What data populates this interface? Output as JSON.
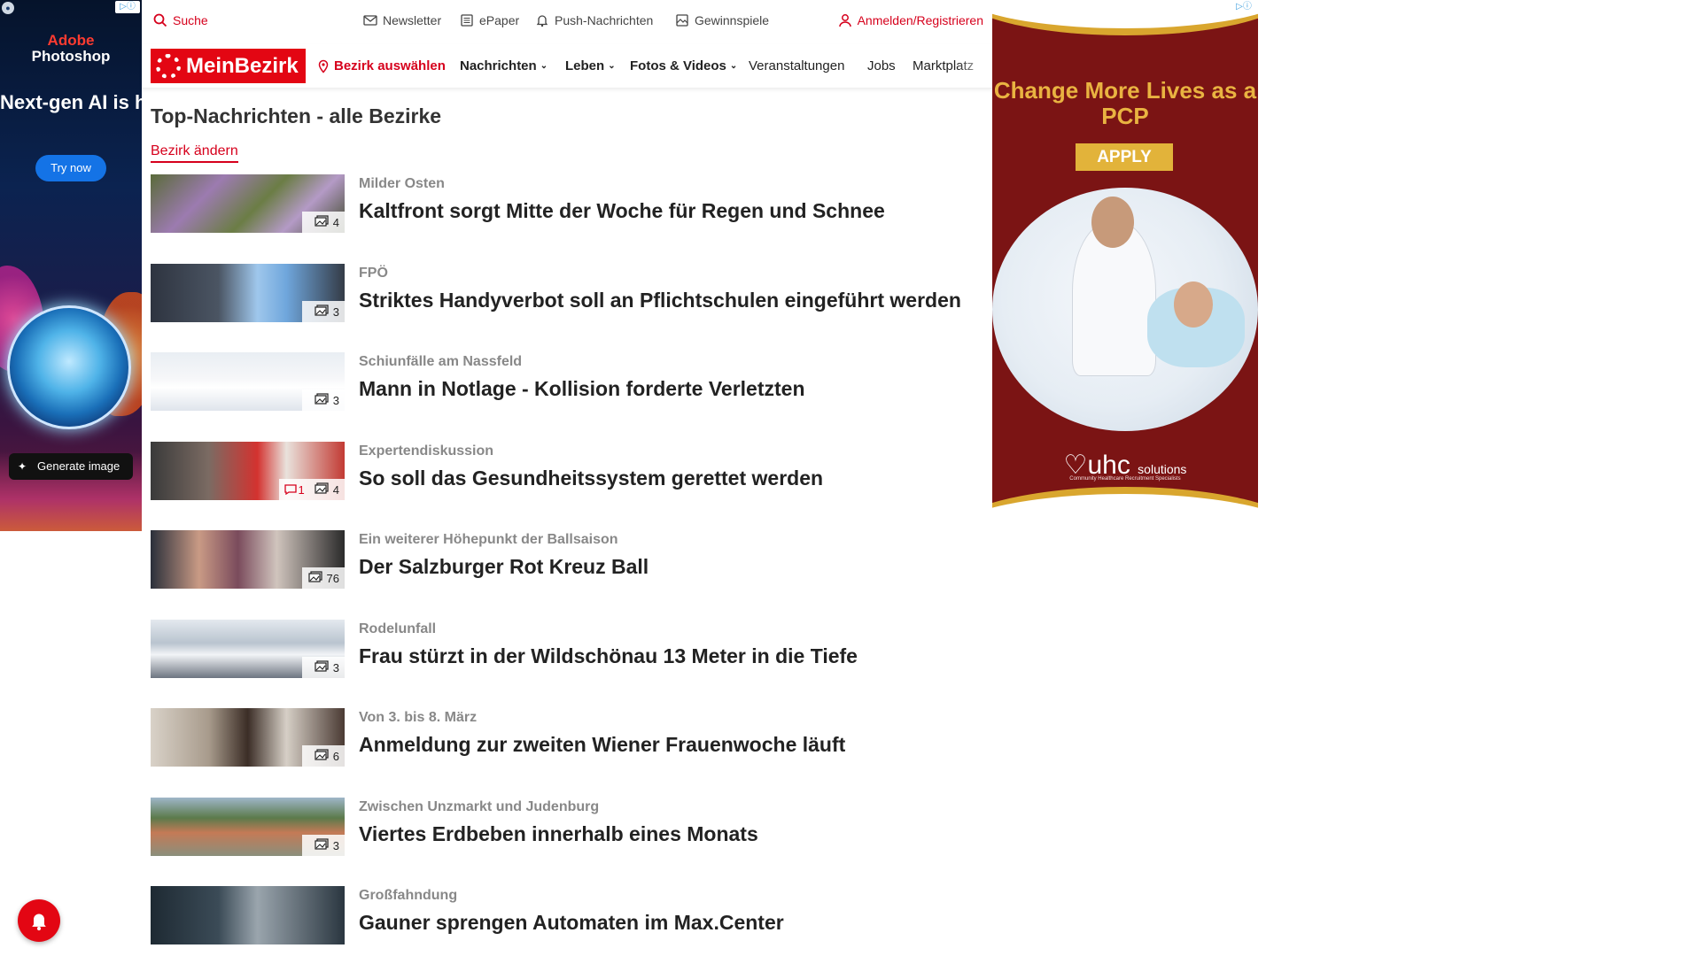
{
  "ads": {
    "left": {
      "brand_line1": "Adobe",
      "brand_line2": "Photoshop",
      "headline": "Next-gen AI is here.",
      "cta": "Try now",
      "generate_label": "Generate image",
      "badge": "▷ⓘ"
    },
    "right": {
      "title": "Change More Lives as a PCP",
      "cta": "APPLY",
      "logo": "uhc",
      "logo_suffix": "solutions",
      "tagline": "Community Healthcare Recruitment Specialists",
      "badge": "▷ⓘ",
      "bg_color": "#7b1414",
      "accent_color": "#e2b33a"
    }
  },
  "topbar": {
    "search": "Suche",
    "newsletter": "Newsletter",
    "epaper": "ePaper",
    "push": "Push-Nachrichten",
    "gewinnspiele": "Gewinnspiele",
    "login": "Anmelden/Registrieren"
  },
  "nav": {
    "logo": "MeinBezirk",
    "bezirk": "Bezirk auswählen",
    "items": [
      {
        "label": "Nachrichten",
        "dropdown": true
      },
      {
        "label": "Leben",
        "dropdown": true
      },
      {
        "label": "Fotos & Videos",
        "dropdown": true
      },
      {
        "label": "Veranstaltungen",
        "dropdown": false
      },
      {
        "label": "Jobs",
        "dropdown": false
      },
      {
        "label": "Marktplatz",
        "dropdown": false
      }
    ],
    "brand_color": "#e30613"
  },
  "page": {
    "title": "Top-Nachrichten - alle Bezirke",
    "change_link": "Bezirk ändern"
  },
  "articles": [
    {
      "kicker": "Milder Osten",
      "headline": "Kaltfront sorgt Mitte der Woche für Regen und Schnee",
      "images": "4",
      "comments": "",
      "thumb": "flowers"
    },
    {
      "kicker": "FPÖ",
      "headline": "Striktes Handyverbot soll an Pflichtschulen eingeführt werden",
      "images": "3",
      "comments": "",
      "thumb": "phone"
    },
    {
      "kicker": "Schiunfälle am Nassfeld",
      "headline": "Mann in Notlage - Kollision forderte Verletzten",
      "images": "3",
      "comments": "",
      "thumb": "helicopter"
    },
    {
      "kicker": "Expertendiskussion",
      "headline": "So soll das Gesundheitssystem gerettet werden",
      "images": "4",
      "comments": "1",
      "thumb": "panel"
    },
    {
      "kicker": "Ein weiterer Höhepunkt der Ballsaison",
      "headline": "Der Salzburger Rot Kreuz Ball",
      "images": "76",
      "comments": "",
      "thumb": "ball"
    },
    {
      "kicker": "Rodelunfall",
      "headline": "Frau stürzt in der Wildschönau 13 Meter in die Tiefe",
      "images": "3",
      "comments": "",
      "thumb": "sled"
    },
    {
      "kicker": "Von 3. bis 8. März",
      "headline": "Anmeldung zur zweiten Wiener Frauenwoche läuft",
      "images": "6",
      "comments": "",
      "thumb": "women"
    },
    {
      "kicker": "Zwischen Unzmarkt und Judenburg",
      "headline": "Viertes Erdbeben innerhalb eines Monats",
      "images": "3",
      "comments": "",
      "thumb": "town"
    },
    {
      "kicker": "Großfahndung",
      "headline": "Gauner sprengen Automaten im Max.Center",
      "images": "",
      "comments": "",
      "thumb": "car"
    }
  ]
}
